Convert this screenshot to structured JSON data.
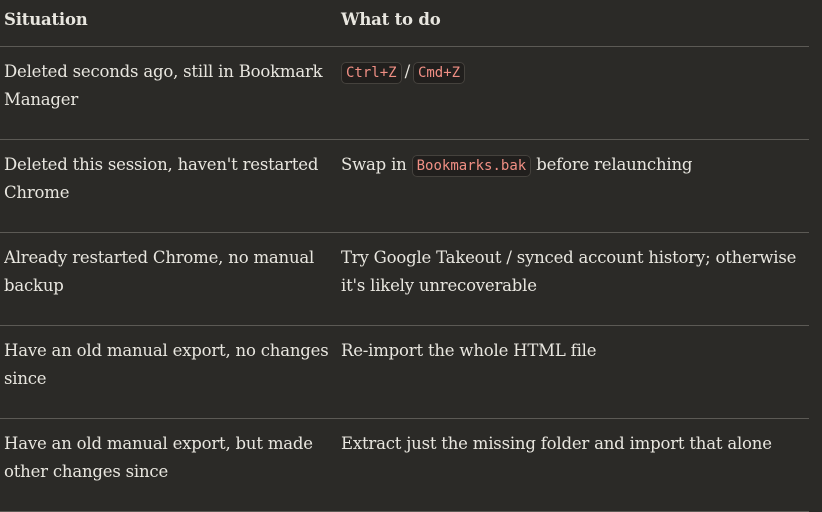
{
  "table": {
    "headers": [
      "Situation",
      "What to do"
    ],
    "rows": [
      {
        "situation": "Deleted seconds ago, still in Bookmark Manager",
        "action": {
          "code1": "Ctrl+Z",
          "sep": "/",
          "code2": "Cmd+Z"
        }
      },
      {
        "situation": "Deleted this session, haven't restarted Chrome",
        "action": {
          "pre": "Swap in",
          "code": "Bookmarks.bak",
          "post": "before relaunching"
        }
      },
      {
        "situation": "Already restarted Chrome, no manual backup",
        "action": {
          "text": "Try Google Takeout / synced account history; otherwise it's likely unrecoverable"
        }
      },
      {
        "situation": "Have an old manual export, no changes since",
        "action": {
          "text": "Re-import the whole HTML file"
        }
      },
      {
        "situation": "Have an old manual export, but made other changes since",
        "action": {
          "text": "Extract just the missing folder and import that alone"
        }
      }
    ]
  }
}
